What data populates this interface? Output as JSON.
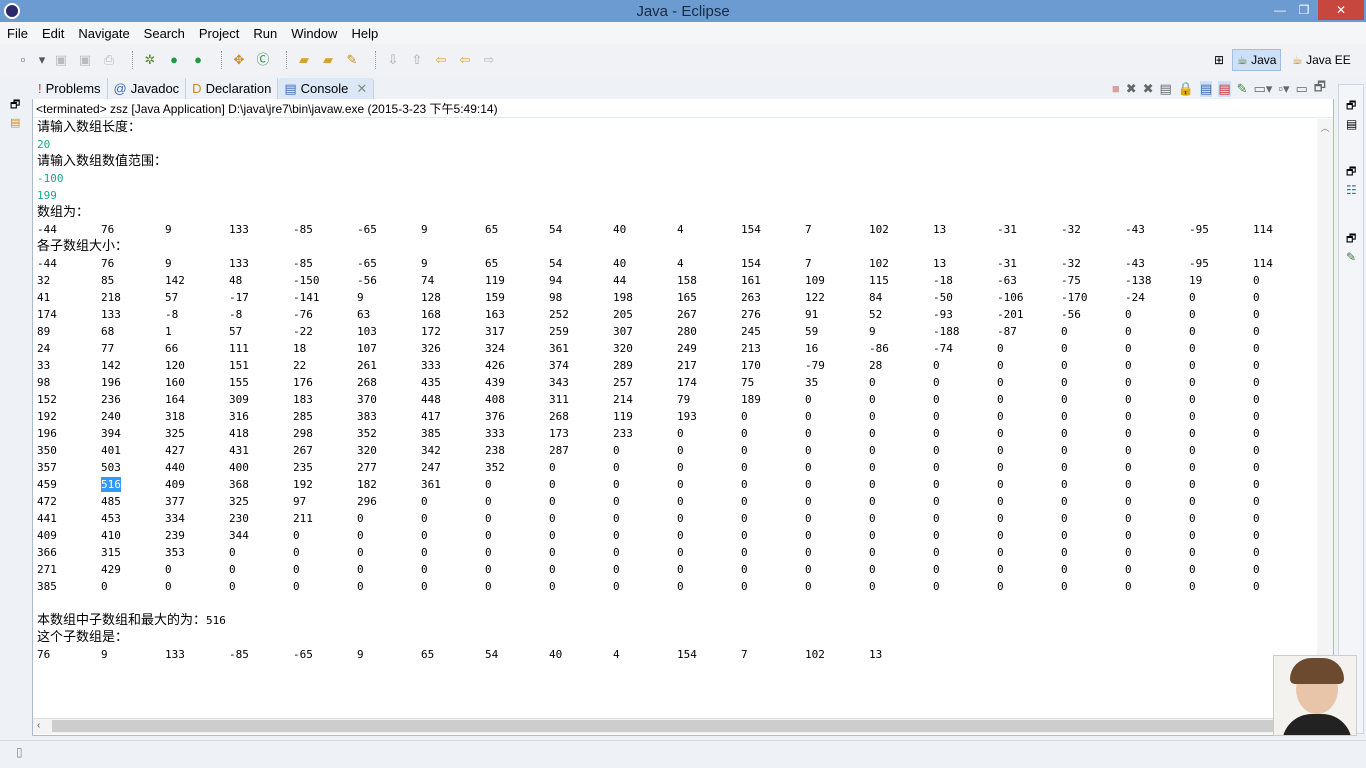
{
  "window": {
    "title": "Java - Eclipse",
    "minimize": "—",
    "maximize": "❐",
    "close": "✕"
  },
  "menu": [
    "File",
    "Edit",
    "Navigate",
    "Search",
    "Project",
    "Run",
    "Window",
    "Help"
  ],
  "perspectives": {
    "java": "Java",
    "javaee": "Java EE"
  },
  "tabs": [
    {
      "label": "Problems",
      "icon": "!"
    },
    {
      "label": "Javadoc",
      "icon": "@"
    },
    {
      "label": "Declaration",
      "icon": "D"
    },
    {
      "label": "Console",
      "icon": "▤"
    }
  ],
  "console": {
    "header": "<terminated> zsz [Java Application] D:\\java\\jre7\\bin\\javaw.exe (2015-3-23 下午5:49:14)",
    "prompt_length": "请输入数组长度：",
    "input_length": "20",
    "prompt_range": "请输入数组数值范围：",
    "input_min": "-100",
    "input_max": "199",
    "array_label": "数组为：",
    "array": [
      "-44",
      "76",
      "9",
      "133",
      "-85",
      "-65",
      "9",
      "65",
      "54",
      "40",
      "4",
      "154",
      "7",
      "102",
      "13",
      "-31",
      "-32",
      "-43",
      "-95",
      "114"
    ],
    "sub_label": "各子数组大小：",
    "rows": [
      [
        "-44",
        "76",
        "9",
        "133",
        "-85",
        "-65",
        "9",
        "65",
        "54",
        "40",
        "4",
        "154",
        "7",
        "102",
        "13",
        "-31",
        "-32",
        "-43",
        "-95",
        "114"
      ],
      [
        "32",
        "85",
        "142",
        "48",
        "-150",
        "-56",
        "74",
        "119",
        "94",
        "44",
        "158",
        "161",
        "109",
        "115",
        "-18",
        "-63",
        "-75",
        "-138",
        "19",
        "0"
      ],
      [
        "41",
        "218",
        "57",
        "-17",
        "-141",
        "9",
        "128",
        "159",
        "98",
        "198",
        "165",
        "263",
        "122",
        "84",
        "-50",
        "-106",
        "-170",
        "-24",
        "0",
        "0"
      ],
      [
        "174",
        "133",
        "-8",
        "-8",
        "-76",
        "63",
        "168",
        "163",
        "252",
        "205",
        "267",
        "276",
        "91",
        "52",
        "-93",
        "-201",
        "-56",
        "0",
        "0",
        "0"
      ],
      [
        "89",
        "68",
        "1",
        "57",
        "-22",
        "103",
        "172",
        "317",
        "259",
        "307",
        "280",
        "245",
        "59",
        "9",
        "-188",
        "-87",
        "0",
        "0",
        "0",
        "0"
      ],
      [
        "24",
        "77",
        "66",
        "111",
        "18",
        "107",
        "326",
        "324",
        "361",
        "320",
        "249",
        "213",
        "16",
        "-86",
        "-74",
        "0",
        "0",
        "0",
        "0",
        "0"
      ],
      [
        "33",
        "142",
        "120",
        "151",
        "22",
        "261",
        "333",
        "426",
        "374",
        "289",
        "217",
        "170",
        "-79",
        "28",
        "0",
        "0",
        "0",
        "0",
        "0",
        "0"
      ],
      [
        "98",
        "196",
        "160",
        "155",
        "176",
        "268",
        "435",
        "439",
        "343",
        "257",
        "174",
        "75",
        "35",
        "0",
        "0",
        "0",
        "0",
        "0",
        "0",
        "0"
      ],
      [
        "152",
        "236",
        "164",
        "309",
        "183",
        "370",
        "448",
        "408",
        "311",
        "214",
        "79",
        "189",
        "0",
        "0",
        "0",
        "0",
        "0",
        "0",
        "0",
        "0"
      ],
      [
        "192",
        "240",
        "318",
        "316",
        "285",
        "383",
        "417",
        "376",
        "268",
        "119",
        "193",
        "0",
        "0",
        "0",
        "0",
        "0",
        "0",
        "0",
        "0",
        "0"
      ],
      [
        "196",
        "394",
        "325",
        "418",
        "298",
        "352",
        "385",
        "333",
        "173",
        "233",
        "0",
        "0",
        "0",
        "0",
        "0",
        "0",
        "0",
        "0",
        "0",
        "0"
      ],
      [
        "350",
        "401",
        "427",
        "431",
        "267",
        "320",
        "342",
        "238",
        "287",
        "0",
        "0",
        "0",
        "0",
        "0",
        "0",
        "0",
        "0",
        "0",
        "0",
        "0"
      ],
      [
        "357",
        "503",
        "440",
        "400",
        "235",
        "277",
        "247",
        "352",
        "0",
        "0",
        "0",
        "0",
        "0",
        "0",
        "0",
        "0",
        "0",
        "0",
        "0",
        "0"
      ],
      [
        "459",
        "516",
        "409",
        "368",
        "192",
        "182",
        "361",
        "0",
        "0",
        "0",
        "0",
        "0",
        "0",
        "0",
        "0",
        "0",
        "0",
        "0",
        "0",
        "0"
      ],
      [
        "472",
        "485",
        "377",
        "325",
        "97",
        "296",
        "0",
        "0",
        "0",
        "0",
        "0",
        "0",
        "0",
        "0",
        "0",
        "0",
        "0",
        "0",
        "0",
        "0"
      ],
      [
        "441",
        "453",
        "334",
        "230",
        "211",
        "0",
        "0",
        "0",
        "0",
        "0",
        "0",
        "0",
        "0",
        "0",
        "0",
        "0",
        "0",
        "0",
        "0",
        "0"
      ],
      [
        "409",
        "410",
        "239",
        "344",
        "0",
        "0",
        "0",
        "0",
        "0",
        "0",
        "0",
        "0",
        "0",
        "0",
        "0",
        "0",
        "0",
        "0",
        "0",
        "0"
      ],
      [
        "366",
        "315",
        "353",
        "0",
        "0",
        "0",
        "0",
        "0",
        "0",
        "0",
        "0",
        "0",
        "0",
        "0",
        "0",
        "0",
        "0",
        "0",
        "0",
        "0"
      ],
      [
        "271",
        "429",
        "0",
        "0",
        "0",
        "0",
        "0",
        "0",
        "0",
        "0",
        "0",
        "0",
        "0",
        "0",
        "0",
        "0",
        "0",
        "0",
        "0",
        "0"
      ],
      [
        "385",
        "0",
        "0",
        "0",
        "0",
        "0",
        "0",
        "0",
        "0",
        "0",
        "0",
        "0",
        "0",
        "0",
        "0",
        "0",
        "0",
        "0",
        "0",
        "0"
      ]
    ],
    "selected": {
      "row": 13,
      "col": 1
    },
    "max_label": "本数组中子数组和最大的为：",
    "max_value": "516",
    "result_label": "这个子数组是：",
    "subarray": [
      "76",
      "9",
      "133",
      "-85",
      "-65",
      "9",
      "65",
      "54",
      "40",
      "4",
      "154",
      "7",
      "102",
      "13"
    ]
  },
  "colors": {
    "input": "#1aa58f",
    "selection": "#3399ff",
    "titlebar": "#6c9bd2"
  }
}
